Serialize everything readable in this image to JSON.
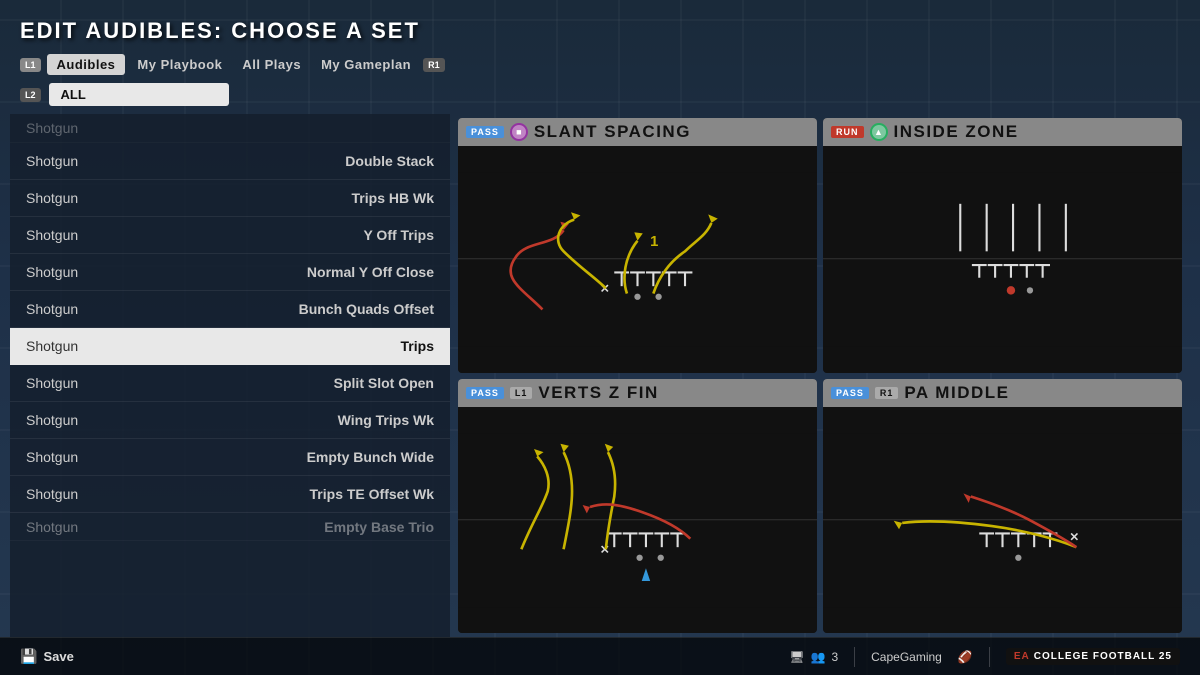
{
  "page": {
    "title": "EDIT AUDIBLES: CHOOSE A SET"
  },
  "tabs": {
    "l1_badge": "L1",
    "r1_badge": "R1",
    "l2_badge": "L2",
    "items": [
      {
        "label": "Audibles",
        "active": true
      },
      {
        "label": "My Playbook",
        "active": false
      },
      {
        "label": "All Plays",
        "active": false
      },
      {
        "label": "My Gameplan",
        "active": false
      }
    ],
    "filter_label": "ALL"
  },
  "play_list": {
    "items": [
      {
        "formation": "Shotgun",
        "play": "",
        "selected": false,
        "scroll_clipped": true
      },
      {
        "formation": "Shotgun",
        "play": "Double Stack",
        "selected": false
      },
      {
        "formation": "Shotgun",
        "play": "Trips HB Wk",
        "selected": false
      },
      {
        "formation": "Shotgun",
        "play": "Y Off Trips",
        "selected": false
      },
      {
        "formation": "Shotgun",
        "play": "Normal Y Off Close",
        "selected": false
      },
      {
        "formation": "Shotgun",
        "play": "Bunch Quads Offset",
        "selected": false
      },
      {
        "formation": "Shotgun",
        "play": "Trips",
        "selected": true
      },
      {
        "formation": "Shotgun",
        "play": "Split Slot Open",
        "selected": false
      },
      {
        "formation": "Shotgun",
        "play": "Wing Trips Wk",
        "selected": false
      },
      {
        "formation": "Shotgun",
        "play": "Empty Bunch Wide",
        "selected": false
      },
      {
        "formation": "Shotgun",
        "play": "Trips TE Offset Wk",
        "selected": false
      },
      {
        "formation": "Shotgun",
        "play": "Empty Base Trio",
        "selected": false,
        "clipped": true
      }
    ]
  },
  "play_cards": [
    {
      "id": "card1",
      "type": "PASS",
      "type_class": "pass",
      "icon_type": "circle",
      "title": "SLANT SPACING",
      "button_badge": ""
    },
    {
      "id": "card2",
      "type": "RUN",
      "type_class": "run",
      "icon_type": "triangle",
      "title": "INSIDE ZONE",
      "button_badge": ""
    },
    {
      "id": "card3",
      "type": "PASS",
      "type_class": "pass",
      "icon_type": "square",
      "title": "VERTS Z FIN",
      "button_badge": "L1"
    },
    {
      "id": "card4",
      "type": "PASS",
      "type_class": "pass",
      "icon_type": "circle",
      "title": "PA MIDDLE",
      "button_badge": "R1"
    }
  ],
  "bottom_bar": {
    "save_label": "Save",
    "player_count": "3",
    "username": "CapeGaming",
    "brand": "COLLEGE FOOTBALL 25"
  },
  "icons": {
    "save": "🖫",
    "users": "👥",
    "screen": "🖥"
  }
}
